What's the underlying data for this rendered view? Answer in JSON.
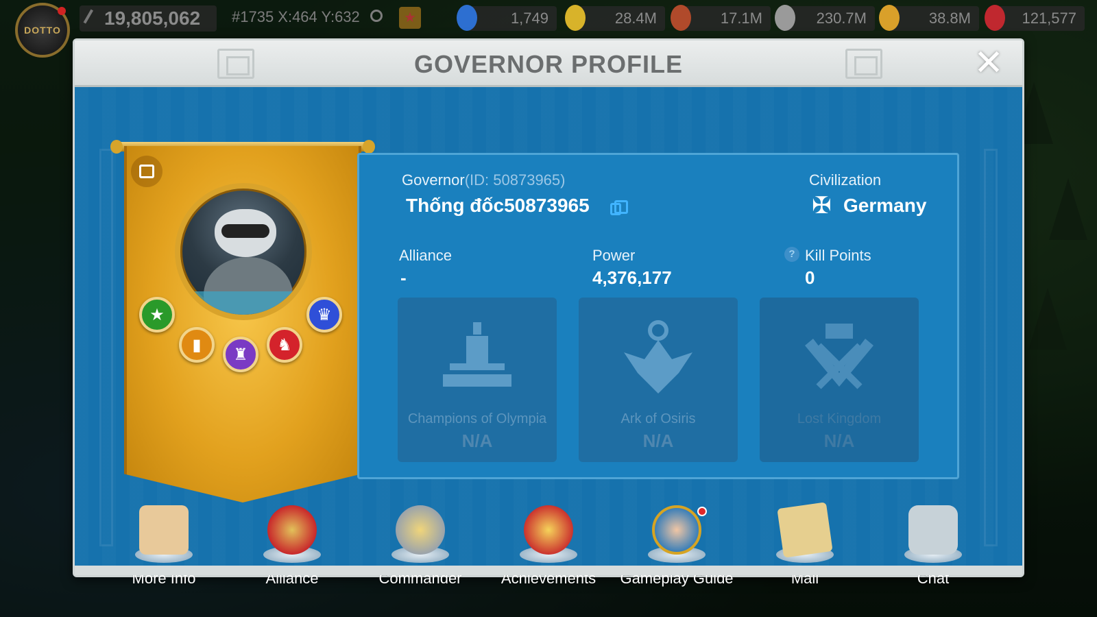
{
  "hud": {
    "city_label": "DOTTO",
    "power": "19,805,062",
    "coordinates": "#1735 X:464 Y:632",
    "resources": [
      {
        "name": "gems",
        "value": "1,749",
        "color": "#2d6fd1"
      },
      {
        "name": "food",
        "value": "28.4M",
        "color": "#d8b32a"
      },
      {
        "name": "wood",
        "value": "17.1M",
        "color": "#b04a2b"
      },
      {
        "name": "stone",
        "value": "230.7M",
        "color": "#9a9a9a"
      },
      {
        "name": "gold",
        "value": "38.8M",
        "color": "#d9a02a"
      },
      {
        "name": "rubies",
        "value": "121,577",
        "color": "#c0282f"
      }
    ]
  },
  "modal": {
    "title": "GOVERNOR PROFILE",
    "close_label": "✕"
  },
  "profile": {
    "governor_label": "Governor",
    "governor_id": "(ID: 50873965)",
    "governor_name": "Thống đốc50873965",
    "civilization_label": "Civilization",
    "civilization_flag": "✠",
    "civilization": "Germany",
    "alliance_label": "Alliance",
    "alliance": "-",
    "power_label": "Power",
    "power": "4,376,177",
    "kill_points_label": "Kill Points",
    "kill_points": "0",
    "help_glyph": "?"
  },
  "badges": [
    {
      "name": "star-badge",
      "glyph": "★",
      "color": "#2a9a2a"
    },
    {
      "name": "cards-badge",
      "glyph": "▮",
      "color": "#e08a12"
    },
    {
      "name": "tower-badge",
      "glyph": "♜",
      "color": "#7a3ac4"
    },
    {
      "name": "lion-badge",
      "glyph": "♞",
      "color": "#d4232b"
    },
    {
      "name": "trophy-badge",
      "glyph": "♛",
      "color": "#2f4fd8"
    }
  ],
  "events": [
    {
      "name": "Champions of Olympia",
      "rank": "N/A",
      "glyph": "⛩"
    },
    {
      "name": "Ark of Osiris",
      "rank": "N/A",
      "glyph": "☥"
    },
    {
      "name": "Lost Kingdom",
      "rank": "N/A",
      "glyph": "⚔"
    }
  ],
  "actions": [
    {
      "label": "More Info",
      "glyph": "📜",
      "color": "#e8c99a"
    },
    {
      "label": "Alliance",
      "glyph": "🛡",
      "color": "#c8282b"
    },
    {
      "label": "Commander",
      "glyph": "⛑",
      "color": "#d6b34a"
    },
    {
      "label": "Achievements",
      "glyph": "★",
      "color": "#d6a423"
    },
    {
      "label": "Gameplay Guide",
      "glyph": "☺",
      "color": "#3b7fb8"
    },
    {
      "label": "Mail",
      "glyph": "✉",
      "color": "#e6cf8f"
    },
    {
      "label": "Chat",
      "glyph": "💬",
      "color": "#c7d2d8"
    }
  ]
}
